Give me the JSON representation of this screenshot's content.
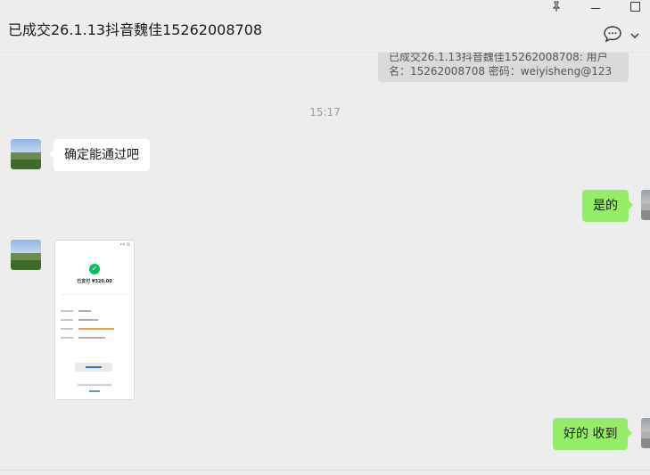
{
  "window": {
    "title": "已成交26.1.13抖音魏佳15262008708",
    "controls": [
      "pin-icon",
      "minimize-icon",
      "maximize-icon"
    ],
    "toolbar_icons": [
      "chat-bubble-icon",
      "chevron-down-icon"
    ]
  },
  "messages": {
    "quoted": "已成交26.1.13抖音魏佳15262008708: 用户名：15262008708  密码：weiyisheng@123",
    "time": "15:17",
    "m1": "确定能通过吧",
    "m2": "是的",
    "m3_image": "payment-screenshot",
    "m4": "好的 收到"
  },
  "payment_screenshot": {
    "paid_amount": "已支付 ¥320.00",
    "status_color": "#07c160"
  },
  "colors": {
    "background": "#ededed",
    "incoming_bubble": "#ffffff",
    "outgoing_bubble": "#95ec69"
  }
}
